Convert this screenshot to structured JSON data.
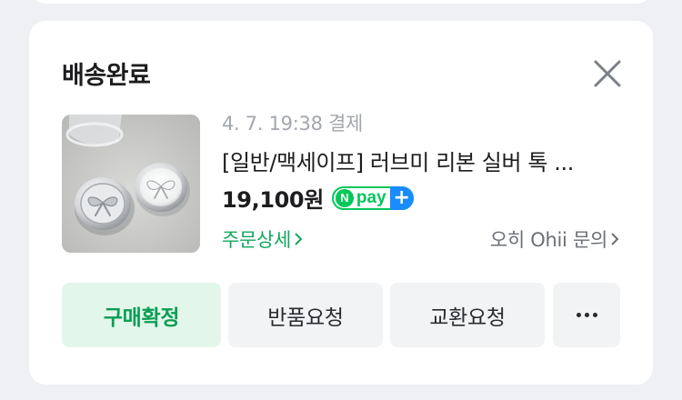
{
  "order": {
    "status_title": "배송완료",
    "paid_info": "4. 7. 19:38 결제",
    "product_name": "[일반/맥세이프] 러브미 리본 실버 톡 ...",
    "price": "19,100원",
    "payment_badge": {
      "n": "N",
      "text": "pay",
      "plus": "+"
    },
    "order_detail_link": "주문상세",
    "seller_inquiry_link": "오히 Ohii 문의",
    "thumbnail_icon": "product-image"
  },
  "actions": {
    "confirm_label": "구매확정",
    "return_label": "반품요청",
    "exchange_label": "교환요청",
    "more_icon": "more-dots-icon"
  },
  "colors": {
    "accent_green": "#0a9e55",
    "confirm_bg": "#e3f6ea",
    "npay_green": "#03c75a",
    "npay_blue": "#1a8cff"
  }
}
